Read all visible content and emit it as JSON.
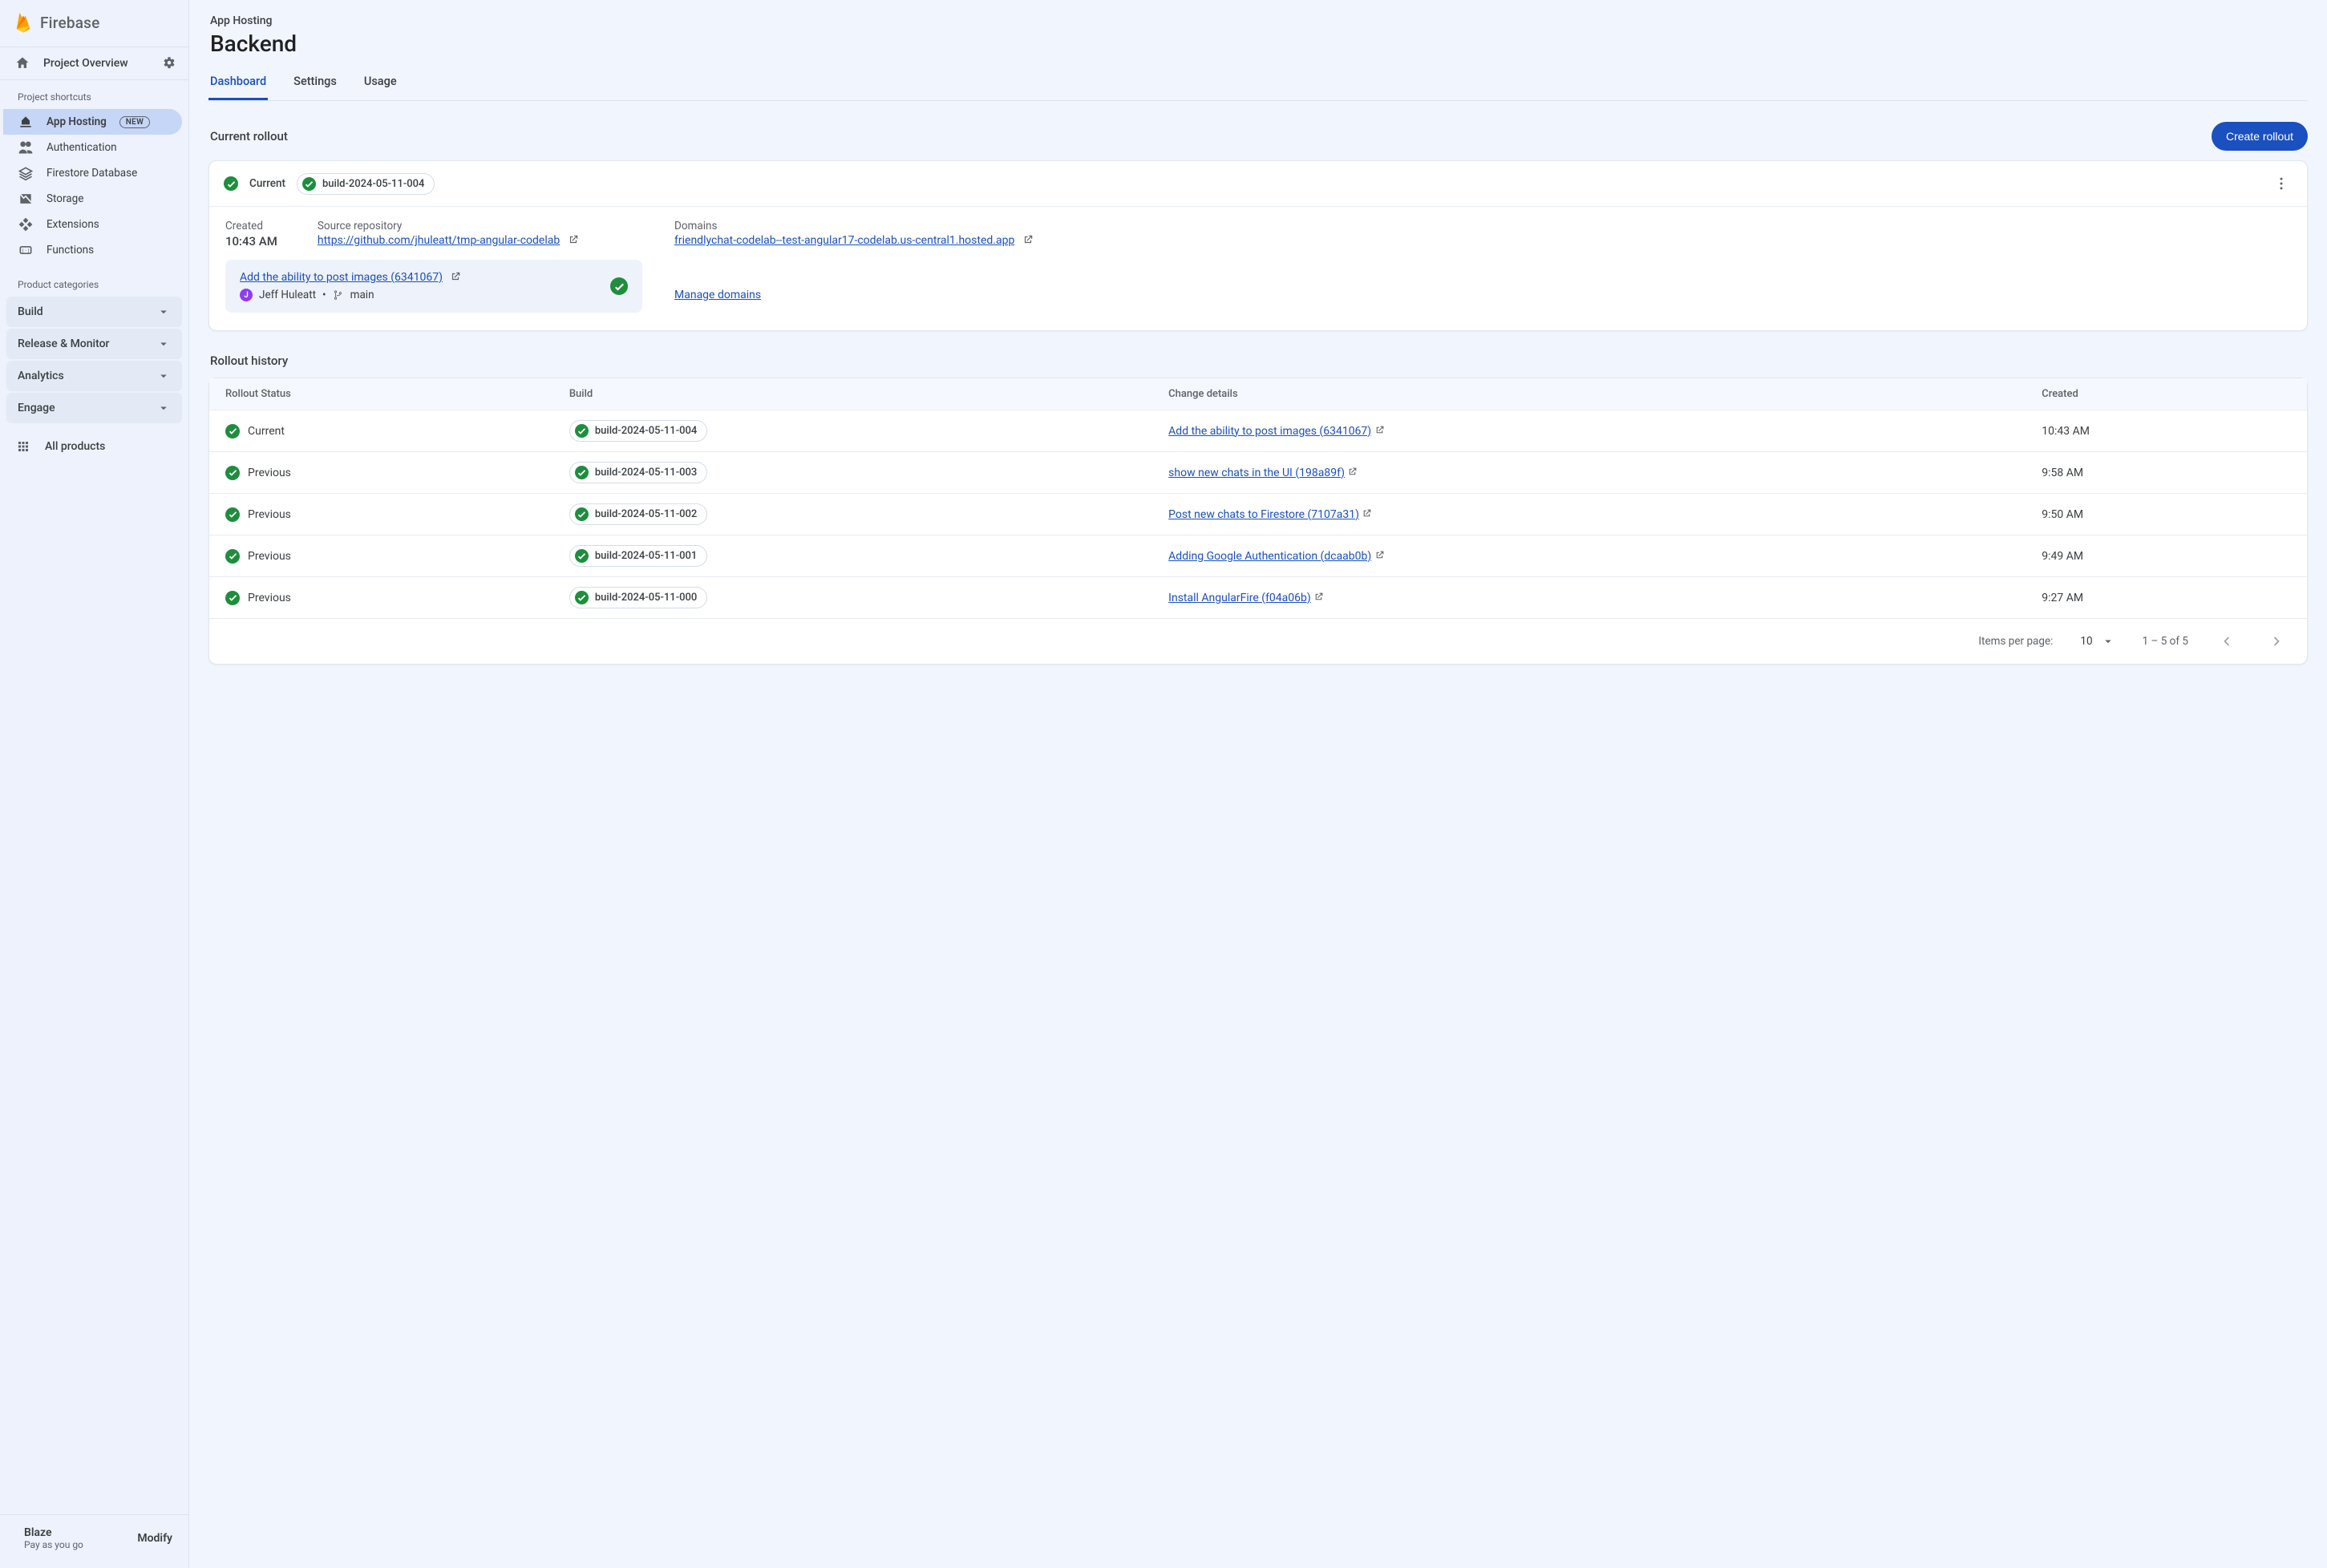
{
  "brand": {
    "name": "Firebase"
  },
  "sidebar": {
    "projectOverview": "Project Overview",
    "shortcutsLabel": "Project shortcuts",
    "newBadge": "NEW",
    "shortcuts": [
      {
        "label": "App Hosting",
        "active": true,
        "new": true
      },
      {
        "label": "Authentication"
      },
      {
        "label": "Firestore Database"
      },
      {
        "label": "Storage"
      },
      {
        "label": "Extensions"
      },
      {
        "label": "Functions"
      }
    ],
    "categoriesLabel": "Product categories",
    "categories": [
      {
        "label": "Build"
      },
      {
        "label": "Release & Monitor"
      },
      {
        "label": "Analytics"
      },
      {
        "label": "Engage"
      }
    ],
    "allProducts": "All products",
    "plan": {
      "name": "Blaze",
      "sub": "Pay as you go",
      "modify": "Modify"
    }
  },
  "header": {
    "crumb": "App Hosting",
    "title": "Backend",
    "tabs": [
      {
        "label": "Dashboard",
        "active": true
      },
      {
        "label": "Settings"
      },
      {
        "label": "Usage"
      }
    ]
  },
  "currentRollout": {
    "sectionTitle": "Current rollout",
    "createButton": "Create rollout",
    "statusLabel": "Current",
    "buildChip": "build-2024-05-11-004",
    "createdLabel": "Created",
    "createdValue": "10:43 AM",
    "repoLabel": "Source repository",
    "repoUrl": "https://github.com/jhuleatt/tmp-angular-codelab",
    "domainsLabel": "Domains",
    "domainUrl": "friendlychat-codelab--test-angular17-codelab.us-central1.hosted.app",
    "commitTitle": "Add the ability to post images (6341067)",
    "author": "Jeff Huleatt",
    "branch": "main",
    "manageDomains": "Manage domains"
  },
  "history": {
    "sectionTitle": "Rollout history",
    "columns": {
      "status": "Rollout Status",
      "build": "Build",
      "change": "Change details",
      "created": "Created"
    },
    "rows": [
      {
        "status": "Current",
        "build": "build-2024-05-11-004",
        "change": "Add the ability to post images (6341067)",
        "created": "10:43 AM"
      },
      {
        "status": "Previous",
        "build": "build-2024-05-11-003",
        "change": "show new chats in the UI (198a89f)",
        "created": "9:58 AM"
      },
      {
        "status": "Previous",
        "build": "build-2024-05-11-002",
        "change": "Post new chats to Firestore (7107a31)",
        "created": "9:50 AM"
      },
      {
        "status": "Previous",
        "build": "build-2024-05-11-001",
        "change": "Adding Google Authentication (dcaab0b)",
        "created": "9:49 AM"
      },
      {
        "status": "Previous",
        "build": "build-2024-05-11-000",
        "change": "Install AngularFire (f04a06b)",
        "created": "9:27 AM"
      }
    ],
    "pager": {
      "itemsLabel": "Items per page:",
      "pageSize": "10",
      "range": "1 – 5 of 5"
    }
  }
}
